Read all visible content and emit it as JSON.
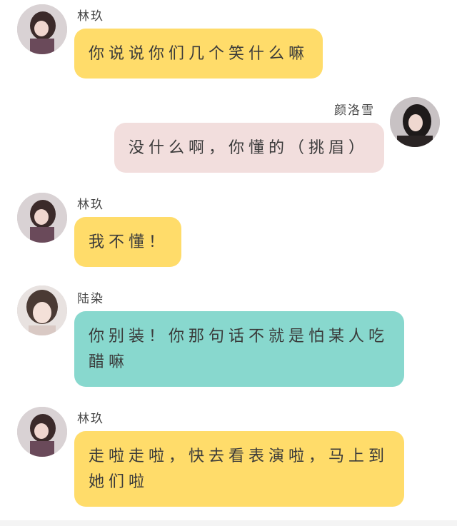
{
  "messages": [
    {
      "sender": "林玖",
      "text": "你说说你们几个笑什么嘛",
      "side": "left",
      "color": "#ffdc6a"
    },
    {
      "sender": "颜洛雪",
      "text": "没什么啊，你懂的（挑眉）",
      "side": "right",
      "color": "#f2dedd"
    },
    {
      "sender": "林玖",
      "text": "我不懂！",
      "side": "left",
      "color": "#ffdc6a"
    },
    {
      "sender": "陆染",
      "text": "你别装！你那句话不就是怕某人吃醋嘛",
      "side": "left",
      "color": "#88d8ce"
    },
    {
      "sender": "林玖",
      "text": "走啦走啦，快去看表演啦，马上到她们啦",
      "side": "left",
      "color": "#ffdc6a"
    }
  ]
}
